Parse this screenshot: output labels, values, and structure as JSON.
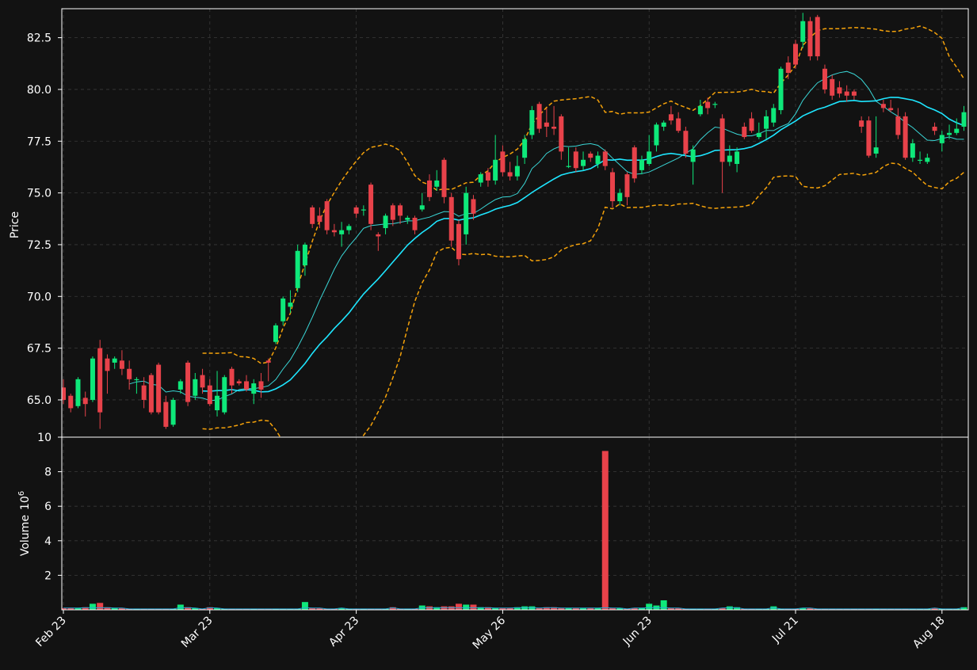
{
  "chart_data": {
    "type": "candlestick",
    "price_panel": {
      "ylabel": "Price",
      "ylim": [
        63.2,
        83.9
      ],
      "yticks": [
        65.0,
        67.5,
        70.0,
        72.5,
        75.0,
        77.5,
        80.0,
        82.5
      ],
      "ytick_labels": [
        "65.0",
        "67.5",
        "70.0",
        "72.5",
        "75.0",
        "77.5",
        "80.0",
        "82.5"
      ],
      "grid": true
    },
    "volume_panel": {
      "ylabel": "Volume",
      "ylabel_exponent": "10",
      "ylabel_exponent_power": "6",
      "ylim": [
        0,
        10
      ],
      "yticks": [
        2,
        4,
        6,
        8,
        10
      ],
      "ytick_labels": [
        "2",
        "4",
        "6",
        "8",
        "10"
      ],
      "grid": true
    },
    "x_tick_labels": [
      {
        "index": 0,
        "label": "Feb 23"
      },
      {
        "index": 20,
        "label": "Mar 23"
      },
      {
        "index": 40,
        "label": "Apr 23"
      },
      {
        "index": 60,
        "label": "May 26"
      },
      {
        "index": 80,
        "label": "Jun 23"
      },
      {
        "index": 100,
        "label": "Jul 21"
      },
      {
        "index": 120,
        "label": "Aug 18"
      }
    ],
    "series_info": {
      "candles": "OHLC",
      "ma_short": "moving average (short)",
      "ma_long": "moving average (long)",
      "bands": "upper/lower band"
    },
    "colors": {
      "background": "#121212",
      "up": "#0ee87a",
      "down": "#e8424a",
      "ma_short": "#3ad6d6",
      "ma_long": "#1ee6ff",
      "band": "#f5a20a",
      "grid": "#3a3a3a",
      "axis": "#ffffff",
      "volume_line": "#2aa8d8"
    }
  }
}
